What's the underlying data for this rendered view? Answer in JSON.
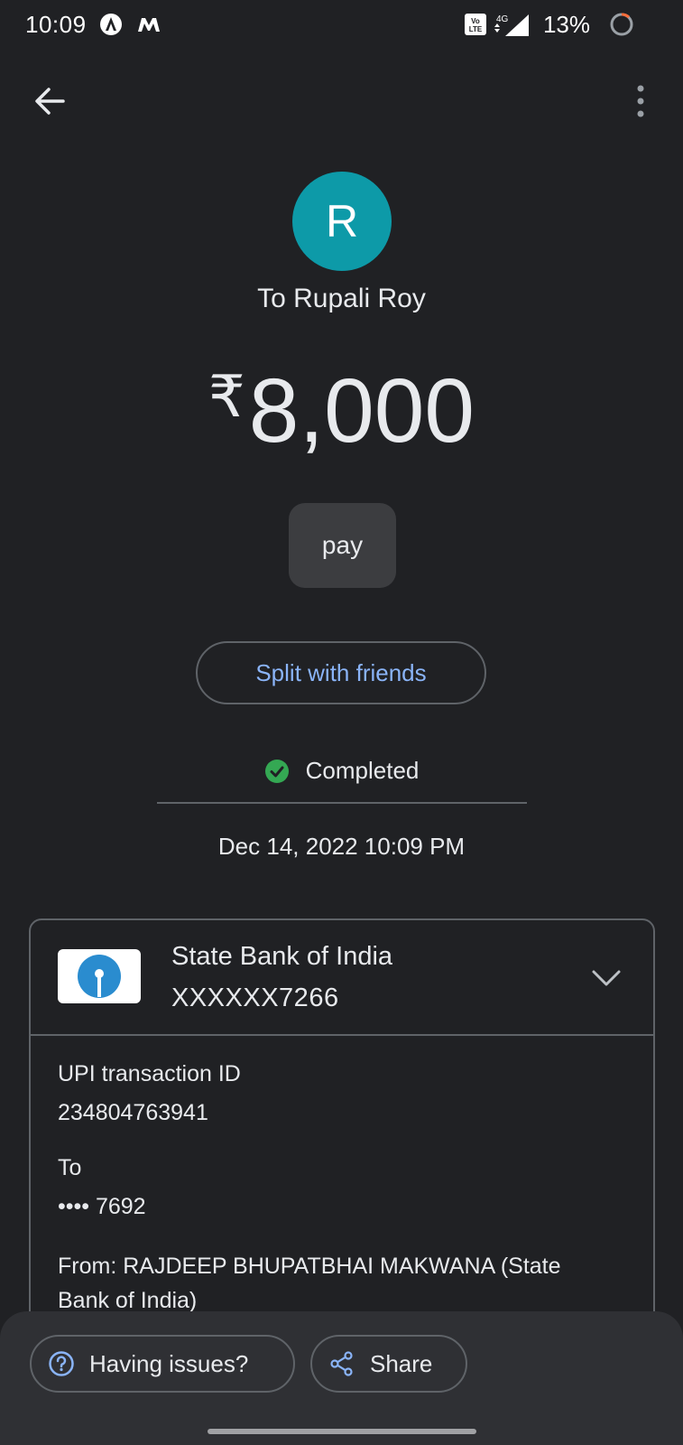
{
  "status_bar": {
    "time": "10:09",
    "network": "4G",
    "battery": "13%"
  },
  "app_bar": {
    "back_icon": "arrow-back-icon",
    "more_icon": "more-vert-icon"
  },
  "payment": {
    "avatar_letter": "R",
    "recipient": "To Rupali Roy",
    "currency": "₹",
    "amount": "8,000",
    "note": "pay",
    "split_label": "Split with friends",
    "status": "Completed",
    "datetime": "Dec 14, 2022 10:09 PM"
  },
  "bank": {
    "name": "State Bank of India",
    "account": "XXXXXX7266"
  },
  "details": {
    "upi_label": "UPI transaction ID",
    "upi_value": "234804763941",
    "to_label": "To",
    "to_value": "•••• 7692",
    "from_line1": "From: RAJDEEP BHUPATBHAI MAKWANA (State",
    "from_line2": "Bank of India)"
  },
  "bottom": {
    "issues_label": "Having issues?",
    "share_label": "Share"
  },
  "colors": {
    "background": "#202124",
    "accent": "#8ab4f8",
    "avatar": "#0d9aa8",
    "success": "#34a853"
  }
}
